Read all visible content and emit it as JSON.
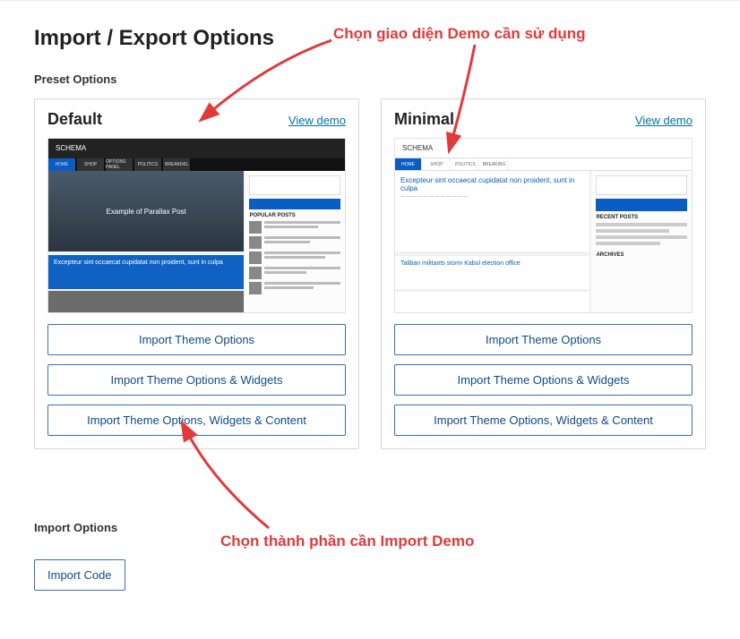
{
  "page_title": "Import / Export Options",
  "preset_options_label": "Preset Options",
  "presets": [
    {
      "title": "Default",
      "view_demo": "View demo",
      "thumb": {
        "logo": "SCHEMA",
        "nav": [
          "HOME",
          "SHOP",
          "OPTIONS PANEL",
          "POLITICS",
          "BREAKING"
        ],
        "hero_text": "Example of Parallax Post",
        "article_title": "Excepteur sint occaecat cupidatat non proident, sunt in culpa",
        "sidebar_heading": "POPULAR POSTS"
      },
      "buttons": {
        "options": "Import Theme Options",
        "options_widgets": "Import Theme Options & Widgets",
        "options_widgets_content": "Import Theme Options, Widgets & Content"
      }
    },
    {
      "title": "Minimal",
      "view_demo": "View demo",
      "thumb": {
        "logo": "SCHEMA",
        "nav": [
          "HOME",
          "SHOP",
          "POLITICS",
          "BREAKING"
        ],
        "article1": "Excepteur sint occaecat cupidatat non proident, sunt in culpa",
        "article2": "Taliban militants storm Kabul election office",
        "sidebar_heading": "RECENT POSTS"
      },
      "buttons": {
        "options": "Import Theme Options",
        "options_widgets": "Import Theme Options & Widgets",
        "options_widgets_content": "Import Theme Options, Widgets & Content"
      }
    }
  ],
  "import_options_label": "Import Options",
  "import_code_button": "Import Code",
  "annotations": {
    "top": "Chọn giao diện Demo cần sử dụng",
    "bottom": "Chọn thành phần cần Import Demo"
  },
  "colors": {
    "annotation": "#e13a3a",
    "link": "#0073aa",
    "button_border": "#3a6fb5",
    "button_text": "#0f4a8a"
  }
}
